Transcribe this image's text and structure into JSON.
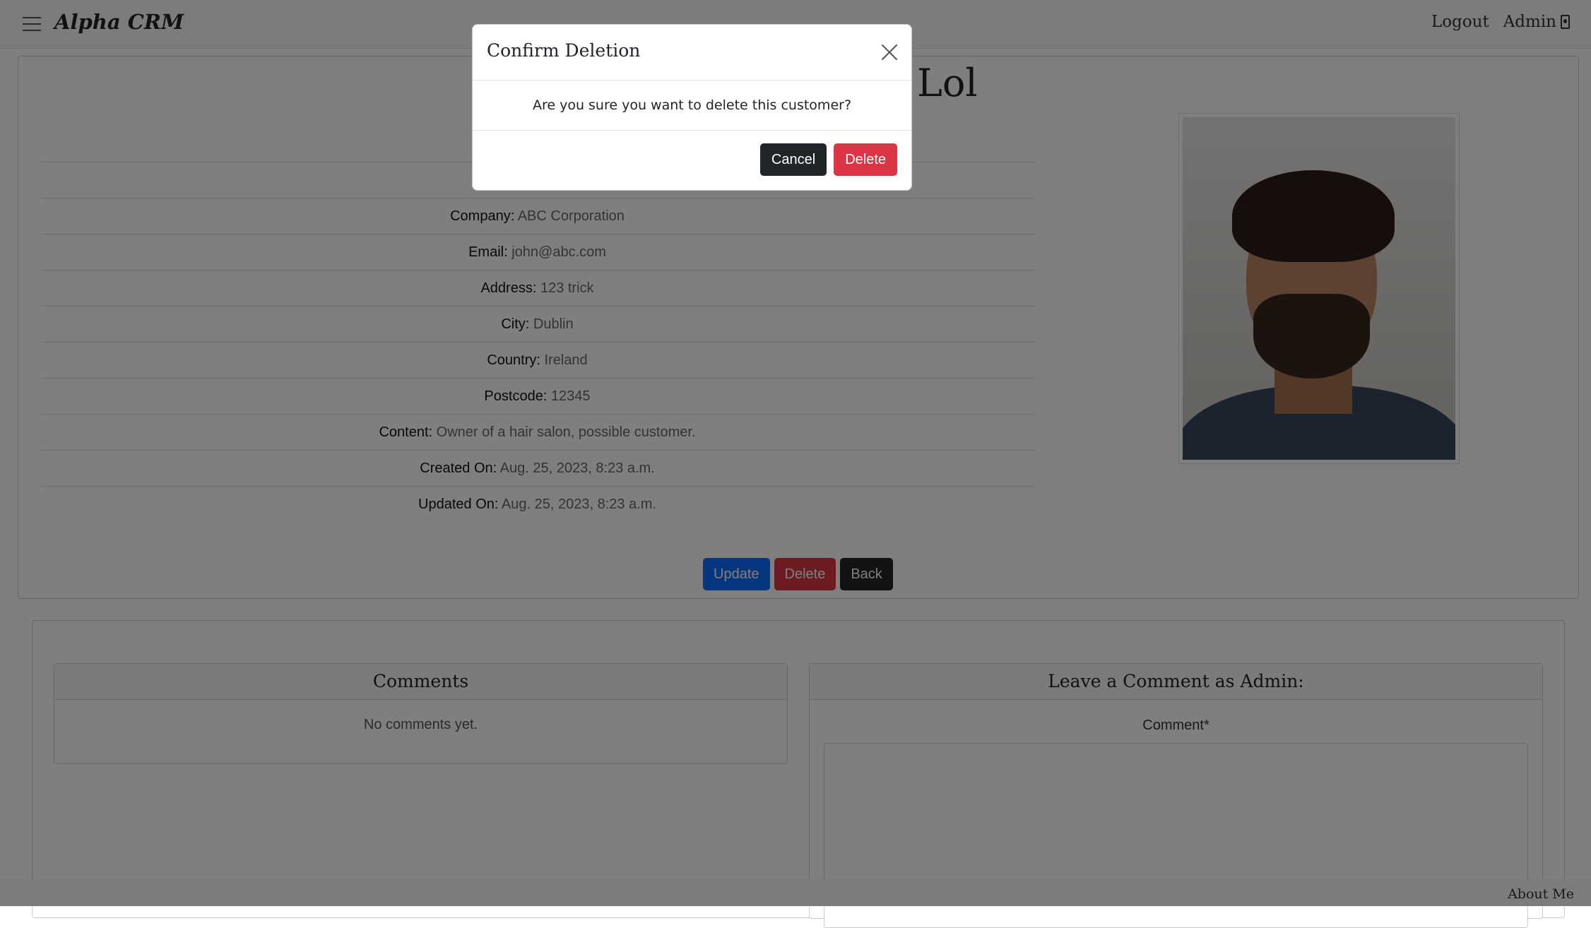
{
  "navbar": {
    "brand": "Alpha CRM",
    "logout": "Logout",
    "admin": "Admin"
  },
  "customer": {
    "name_visible": "Lol",
    "fields": [
      {
        "label": "Company:",
        "value": "ABC Corporation"
      },
      {
        "label": "Email:",
        "value": "john@abc.com"
      },
      {
        "label": "Address:",
        "value": "123 trick"
      },
      {
        "label": "City:",
        "value": "Dublin"
      },
      {
        "label": "Country:",
        "value": "Ireland"
      },
      {
        "label": "Postcode:",
        "value": "12345"
      },
      {
        "label": "Content:",
        "value": "Owner of a hair salon, possible customer."
      },
      {
        "label": "Created On:",
        "value": "Aug. 25, 2023, 8:23 a.m."
      },
      {
        "label": "Updated On:",
        "value": "Aug. 25, 2023, 8:23 a.m."
      }
    ]
  },
  "actions": {
    "update": "Update",
    "delete": "Delete",
    "back": "Back"
  },
  "comments": {
    "heading": "Comments",
    "empty": "No comments yet.",
    "form_heading": "Leave a Comment as Admin:",
    "comment_label": "Comment*"
  },
  "footer": {
    "about": "About Me"
  },
  "modal": {
    "title": "Confirm Deletion",
    "message": "Are you sure you want to delete this customer?",
    "cancel": "Cancel",
    "delete": "Delete"
  },
  "colors": {
    "primary": "#0d6efd",
    "danger": "#dc3545",
    "dark": "#212529"
  }
}
